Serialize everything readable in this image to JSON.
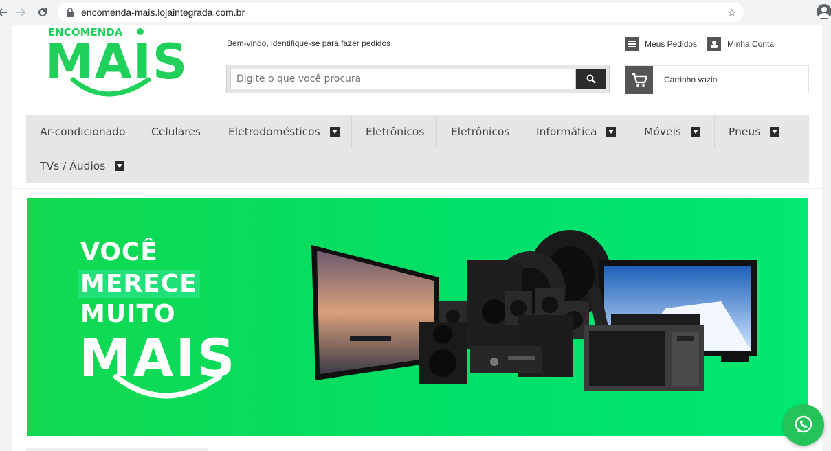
{
  "browser": {
    "url": "encomenda-mais.lojaintegrada.com.br",
    "icons": [
      "back-icon",
      "forward-icon",
      "reload-icon",
      "lock-icon",
      "bookmark-star-icon",
      "profile-icon"
    ]
  },
  "header": {
    "logo_top": "ENCOMENDA",
    "logo_main": "MAIS",
    "welcome": "Bem-vindo, identifique-se para fazer pedidos",
    "search_placeholder": "Digite o que você procura",
    "my_orders": "Meus Pedidos",
    "my_account": "Minha Conta",
    "cart": "Carrinho vazio"
  },
  "menu": {
    "items": [
      {
        "label": "Ar-condicionado"
      },
      {
        "label": "Celulares"
      },
      {
        "label": "Eletrodomésticos"
      },
      {
        "label": "Eletrônicos"
      },
      {
        "label": "Eletrônicos"
      },
      {
        "label": "Informática"
      },
      {
        "label": "Móveis"
      },
      {
        "label": "Pneus"
      },
      {
        "label": "TVs / Áudios"
      }
    ]
  },
  "banner": {
    "line1": "VOCÊ",
    "line2": "MERECE",
    "line3": "MUITO",
    "line4": "MAIS"
  },
  "colors": {
    "brand_green": "#12d84f",
    "menu_bg": "#e6e6e6",
    "dark": "#2b2b2b",
    "whatsapp": "#25c35a"
  }
}
